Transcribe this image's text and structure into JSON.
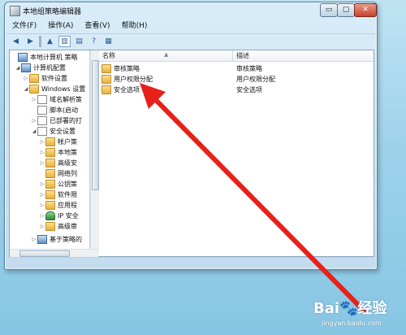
{
  "window": {
    "title": "本地组策略编辑器",
    "controls": {
      "minimize": "▭",
      "maximize": "▢",
      "close": "✕"
    }
  },
  "menu": [
    "文件(F)",
    "操作(A)",
    "查看(V)",
    "帮助(H)"
  ],
  "toolbar": [
    {
      "icon": "back-arrow-icon",
      "glyph": "◀"
    },
    {
      "icon": "forward-arrow-icon",
      "glyph": "▶"
    },
    {
      "icon": "up-folder-icon",
      "glyph": "▲"
    },
    {
      "icon": "show-hide-tree-icon",
      "glyph": "▥"
    },
    {
      "icon": "export-list-icon",
      "glyph": "▤"
    },
    {
      "icon": "help-icon",
      "glyph": "?"
    },
    {
      "icon": "properties-icon",
      "glyph": "▦"
    }
  ],
  "tree": [
    {
      "label": "本地计算机 策略",
      "icon": "computer-policy-icon",
      "toggle": ""
    },
    {
      "label": "计算机配置",
      "icon": "computer-icon",
      "toggle": "◢"
    },
    {
      "label": "软件设置",
      "icon": "folder-icon",
      "toggle": "▷"
    },
    {
      "label": "Windows 设置",
      "icon": "folder-icon",
      "toggle": "◢"
    },
    {
      "label": "域名解析策",
      "icon": "document-icon",
      "toggle": "▷"
    },
    {
      "label": "脚本(启动",
      "icon": "document-icon",
      "toggle": ""
    },
    {
      "label": "已部署的打",
      "icon": "document-icon",
      "toggle": "▷"
    },
    {
      "label": "安全设置",
      "icon": "security-icon",
      "toggle": "◢"
    },
    {
      "label": "帐户策",
      "icon": "folder-icon",
      "toggle": "▷"
    },
    {
      "label": "本地策",
      "icon": "folder-icon",
      "toggle": "▷"
    },
    {
      "label": "高级安",
      "icon": "folder-icon",
      "toggle": "▷"
    },
    {
      "label": "网络列",
      "icon": "folder-icon",
      "toggle": ""
    },
    {
      "label": "公钥策",
      "icon": "folder-icon",
      "toggle": "▷"
    },
    {
      "label": "软件限",
      "icon": "folder-icon",
      "toggle": "▷"
    },
    {
      "label": "应用程",
      "icon": "folder-icon",
      "toggle": "▷"
    },
    {
      "label": "IP 安全",
      "icon": "shield-icon",
      "toggle": "▷"
    },
    {
      "label": "高级审",
      "icon": "folder-icon",
      "toggle": "▷"
    },
    {
      "label": "基于策略的",
      "icon": "chart-icon",
      "toggle": "▷"
    }
  ],
  "list": {
    "columns": {
      "name": "名称",
      "description": "描述"
    },
    "rows": [
      {
        "name": "审核策略",
        "description": "审核策略"
      },
      {
        "name": "用户权限分配",
        "description": "用户权限分配"
      },
      {
        "name": "安全选项",
        "description": "安全选项"
      }
    ]
  },
  "watermark": {
    "logo": "Bai🐾经验",
    "url": "jingyan.baidu.com"
  },
  "colors": {
    "arrow": "#e8201a",
    "title_bar": "#d9ecf9",
    "background": "#9dd2ea"
  }
}
